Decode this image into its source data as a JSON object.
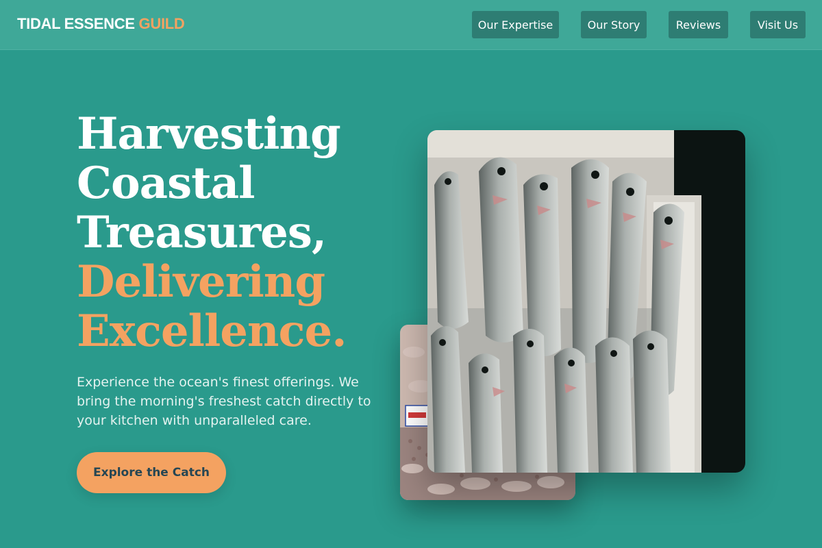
{
  "header": {
    "brand_main": "TIDAL ESSENCE",
    "brand_accent": "GUILD",
    "nav": [
      "Our Expertise",
      "Our Story",
      "Reviews",
      "Visit Us"
    ]
  },
  "hero": {
    "headline_lines": [
      "Harvesting",
      "Coastal",
      "Treasures,"
    ],
    "headline_accent_lines": [
      "Delivering",
      "Excellence."
    ],
    "subtext": "Experience the ocean's finest offerings. We bring the morning's freshest catch directly to your kitchen with unparalleled care.",
    "cta_label": "Explore the Catch"
  },
  "colors": {
    "background": "#2a9a8c",
    "header": "#3fa898",
    "nav_button": "#2e7d73",
    "accent": "#f4a261",
    "cta_text": "#264653"
  }
}
